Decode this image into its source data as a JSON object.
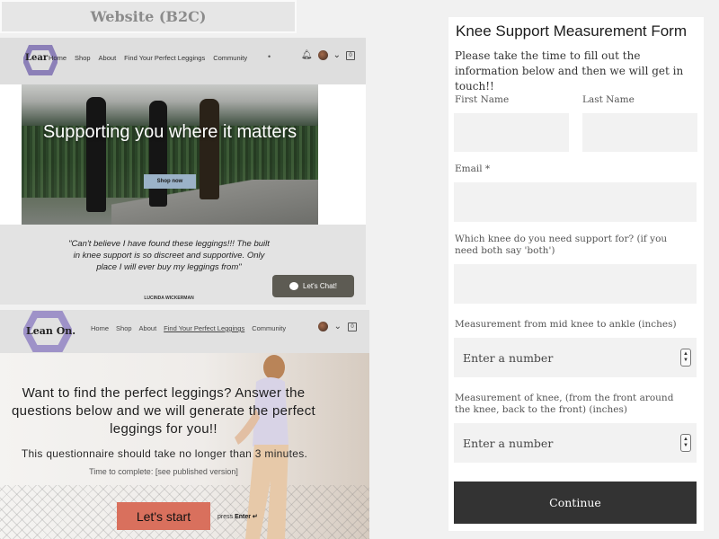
{
  "left_title": "Website (B2C)",
  "site1": {
    "logo_text": "Lear",
    "nav": [
      "Home",
      "Shop",
      "About",
      "Find Your Perfect Leggings",
      "Community"
    ],
    "nav_dot": "•",
    "icons": [
      "bell-icon",
      "avatar",
      "chevron-down-icon",
      "cart-icon"
    ],
    "cart_count": "0",
    "hero_heading": "Supporting you where it matters",
    "shop_button": "Shop now",
    "quote": "\"Can't believe I have found these leggings!!! The built in knee support is so discreet and supportive. Only place I will ever buy my leggings from\"",
    "quote_author": "LUCINDA WICKERMAN",
    "chat_button": "Let's Chat!"
  },
  "site2": {
    "logo_text": "Lean On.",
    "nav": [
      "Home",
      "Shop",
      "About",
      "Find Your Perfect Leggings",
      "Community"
    ],
    "cart_count": "0",
    "heading": "Want to find the perfect leggings? Answer the questions below and we will generate the perfect leggings for you!!",
    "subheading": "This questionnaire should take no longer than 3 minutes.",
    "time_to_complete": "Time to complete: [see published version]",
    "start_button": "Let's start",
    "press_label": "press",
    "enter_label": "Enter ↵"
  },
  "form": {
    "title": "Knee Support Measurement Form",
    "intro": "Please take the time to fill out the information below and then we will get in touch!!",
    "first_name_label": "First Name",
    "last_name_label": "Last Name",
    "email_label": "Email *",
    "knee_label": "Which knee do you need support for? (if you need both say 'both')",
    "ankle_label": "Measurement from mid knee to ankle (inches)",
    "ankle_placeholder": "Enter a number",
    "knee_measure_label": "Measurement of knee, (from the front around the knee, back to the front) (inches)",
    "knee_measure_placeholder": "Enter a number",
    "continue_button": "Continue"
  },
  "colors": {
    "shop_button": "#9bb2c8",
    "chat_button": "#5d5b53",
    "start_button": "#d9705d",
    "continue_button": "#333333",
    "field_bg": "#f2f2f2"
  }
}
